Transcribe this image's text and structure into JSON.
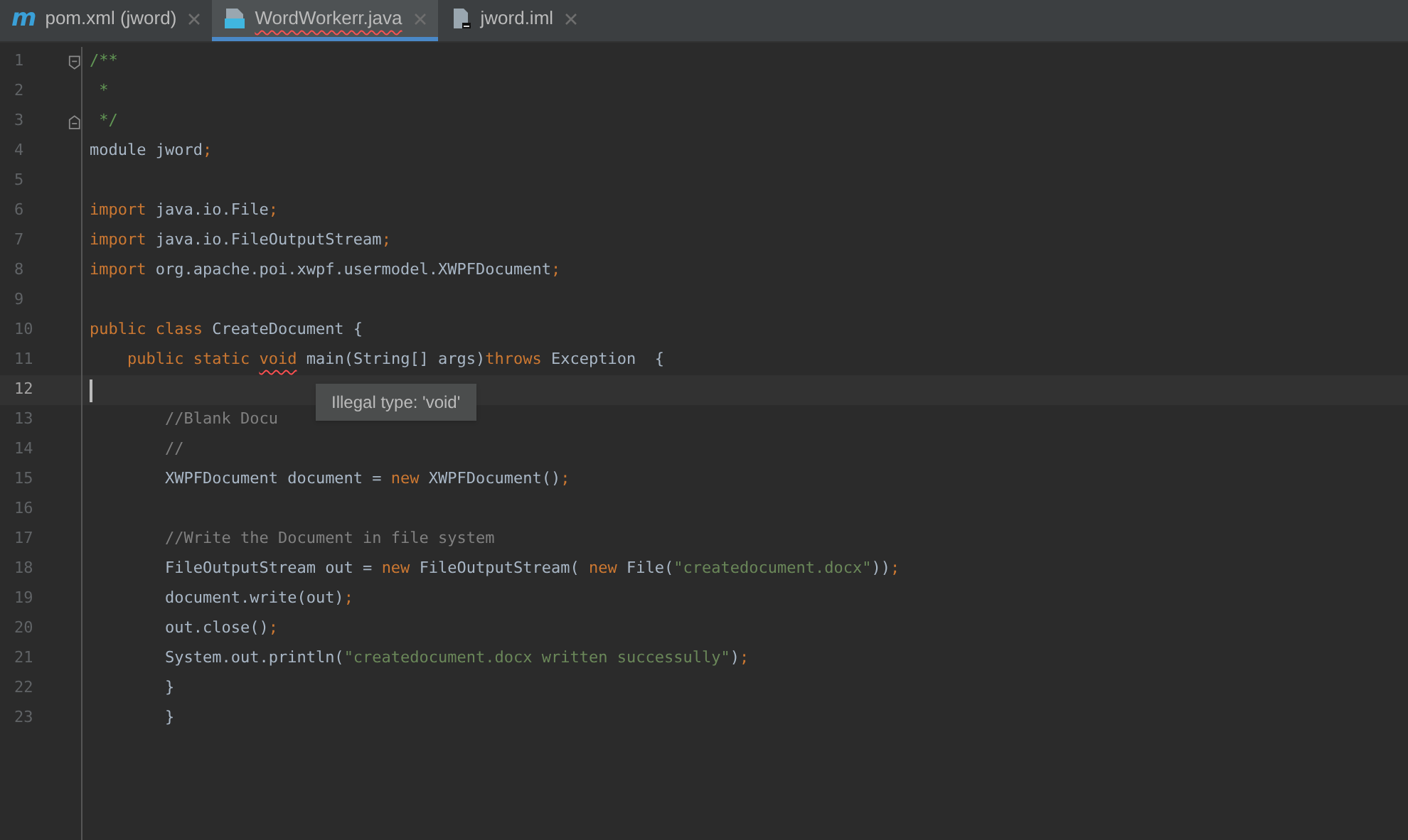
{
  "tabs": [
    {
      "label": "pom.xml (jword)",
      "kind": "maven",
      "icon_text": "m",
      "selected": false,
      "error": false
    },
    {
      "label": "WordWorkerr.java",
      "kind": "java",
      "selected": true,
      "error": true
    },
    {
      "label": "jword.iml",
      "kind": "file",
      "selected": false,
      "error": false
    }
  ],
  "editor": {
    "lines": [
      {
        "number": "1",
        "current": false,
        "kind": "fold_start",
        "tokens": [
          {
            "kind": "doc",
            "text": "/**"
          }
        ]
      },
      {
        "number": "2",
        "current": false,
        "kind": "code",
        "tokens": [
          {
            "kind": "doc",
            "text": " *"
          }
        ]
      },
      {
        "number": "3",
        "current": false,
        "kind": "fold_end",
        "tokens": [
          {
            "kind": "doc",
            "text": " */"
          }
        ]
      },
      {
        "number": "4",
        "current": false,
        "kind": "code",
        "tokens": [
          {
            "kind": "plain",
            "text": "module jword"
          },
          {
            "kind": "keyword",
            "text": ";"
          }
        ]
      },
      {
        "number": "5",
        "current": false,
        "kind": "code"
      },
      {
        "number": "6",
        "current": false,
        "kind": "code",
        "tokens": [
          {
            "kind": "keyword",
            "text": "import "
          },
          {
            "kind": "plain",
            "text": "java.io.File"
          },
          {
            "kind": "keyword",
            "text": ";"
          }
        ]
      },
      {
        "number": "7",
        "current": false,
        "kind": "code",
        "tokens": [
          {
            "kind": "keyword",
            "text": "import "
          },
          {
            "kind": "plain",
            "text": "java.io.FileOutputStream"
          },
          {
            "kind": "keyword",
            "text": ";"
          }
        ]
      },
      {
        "number": "8",
        "current": false,
        "kind": "code",
        "tokens": [
          {
            "kind": "keyword",
            "text": "import "
          },
          {
            "kind": "plain",
            "text": "org.apache.poi.xwpf.usermodel.XWPFDocument"
          },
          {
            "kind": "keyword",
            "text": ";"
          }
        ]
      },
      {
        "number": "9",
        "current": false,
        "kind": "code"
      },
      {
        "number": "10",
        "current": false,
        "kind": "code",
        "tokens": [
          {
            "kind": "keyword",
            "text": "public class "
          },
          {
            "kind": "plain",
            "text": "CreateDocument {"
          }
        ]
      },
      {
        "number": "11",
        "current": false,
        "kind": "code",
        "tokens": [
          {
            "kind": "keyword",
            "text": "    public static "
          },
          {
            "kind": "keyword",
            "text": "void",
            "error": true
          },
          {
            "kind": "plain",
            "text": " main(String[] args)"
          },
          {
            "kind": "keyword",
            "text": "throws "
          },
          {
            "kind": "plain",
            "text": "Exception  {"
          }
        ]
      },
      {
        "number": "12",
        "current": true,
        "kind": "code",
        "caret": true
      },
      {
        "number": "13",
        "current": false,
        "kind": "code",
        "tokens": [
          {
            "kind": "comment",
            "text": "        //Blank Docu"
          }
        ]
      },
      {
        "number": "14",
        "current": false,
        "kind": "code",
        "tokens": [
          {
            "kind": "comment",
            "text": "        //"
          }
        ]
      },
      {
        "number": "15",
        "current": false,
        "kind": "code",
        "tokens": [
          {
            "kind": "plain",
            "text": "        XWPFDocument document = "
          },
          {
            "kind": "keyword",
            "text": "new "
          },
          {
            "kind": "plain",
            "text": "XWPFDocument()"
          },
          {
            "kind": "keyword",
            "text": ";"
          }
        ]
      },
      {
        "number": "16",
        "current": false,
        "kind": "code"
      },
      {
        "number": "17",
        "current": false,
        "kind": "code",
        "tokens": [
          {
            "kind": "comment",
            "text": "        //Write the Document in file system"
          }
        ]
      },
      {
        "number": "18",
        "current": false,
        "kind": "code",
        "tokens": [
          {
            "kind": "plain",
            "text": "        FileOutputStream out = "
          },
          {
            "kind": "keyword",
            "text": "new "
          },
          {
            "kind": "plain",
            "text": "FileOutputStream( "
          },
          {
            "kind": "keyword",
            "text": "new "
          },
          {
            "kind": "plain",
            "text": "File("
          },
          {
            "kind": "string",
            "text": "\"createdocument.docx\""
          },
          {
            "kind": "plain",
            "text": "))"
          },
          {
            "kind": "keyword",
            "text": ";"
          }
        ]
      },
      {
        "number": "19",
        "current": false,
        "kind": "code",
        "tokens": [
          {
            "kind": "plain",
            "text": "        document.write(out)"
          },
          {
            "kind": "keyword",
            "text": ";"
          }
        ]
      },
      {
        "number": "20",
        "current": false,
        "kind": "code",
        "tokens": [
          {
            "kind": "plain",
            "text": "        out.close()"
          },
          {
            "kind": "keyword",
            "text": ";"
          }
        ]
      },
      {
        "number": "21",
        "current": false,
        "kind": "code",
        "tokens": [
          {
            "kind": "plain",
            "text": "        System.out.println("
          },
          {
            "kind": "string",
            "text": "\"createdocument.docx written successully\""
          },
          {
            "kind": "plain",
            "text": ")"
          },
          {
            "kind": "keyword",
            "text": ";"
          }
        ]
      },
      {
        "number": "22",
        "current": false,
        "kind": "code",
        "tokens": [
          {
            "kind": "plain",
            "text": "        }"
          }
        ]
      },
      {
        "number": "23",
        "current": false,
        "kind": "code",
        "tokens": [
          {
            "kind": "plain",
            "text": "        }"
          }
        ]
      }
    ]
  },
  "tooltip": {
    "text": "Illegal type: 'void'"
  }
}
